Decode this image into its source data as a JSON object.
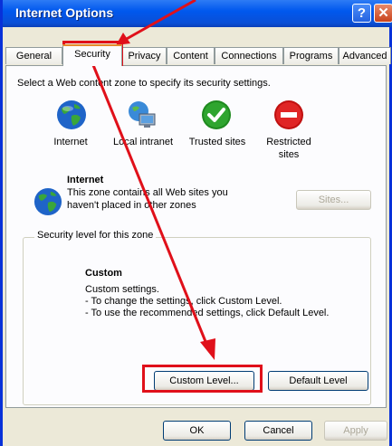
{
  "window": {
    "title": "Internet Options",
    "help_glyph": "?",
    "close_glyph": "✕"
  },
  "tabs": [
    {
      "label": "General",
      "active": false
    },
    {
      "label": "Security",
      "active": true
    },
    {
      "label": "Privacy",
      "active": false
    },
    {
      "label": "Content",
      "active": false
    },
    {
      "label": "Connections",
      "active": false
    },
    {
      "label": "Programs",
      "active": false
    },
    {
      "label": "Advanced",
      "active": false
    }
  ],
  "security": {
    "instruction": "Select a Web content zone to specify its security settings.",
    "zones": [
      {
        "label": "Internet",
        "icon": "globe-icon",
        "selected": true
      },
      {
        "label": "Local intranet",
        "icon": "intranet-icon",
        "selected": false
      },
      {
        "label": "Trusted sites",
        "icon": "checkmark-icon",
        "selected": false
      },
      {
        "label": "Restricted sites",
        "icon": "restricted-icon",
        "selected": false
      }
    ],
    "selected_zone": {
      "name": "Internet",
      "description_line1": "This zone contains all Web sites you",
      "description_line2": "haven't placed in other zones",
      "sites_button": "Sites..."
    },
    "level_group": {
      "title": "Security level for this zone",
      "level_name": "Custom",
      "line1": "Custom settings.",
      "line2": "- To change the settings, click Custom Level.",
      "line3": "- To use the recommended settings, click Default Level.",
      "custom_level_button": "Custom Level...",
      "default_level_button": "Default Level"
    }
  },
  "footer": {
    "ok": "OK",
    "cancel": "Cancel",
    "apply": "Apply"
  },
  "colors": {
    "highlight": "#e0101a",
    "titlebar": "#0058ee"
  }
}
